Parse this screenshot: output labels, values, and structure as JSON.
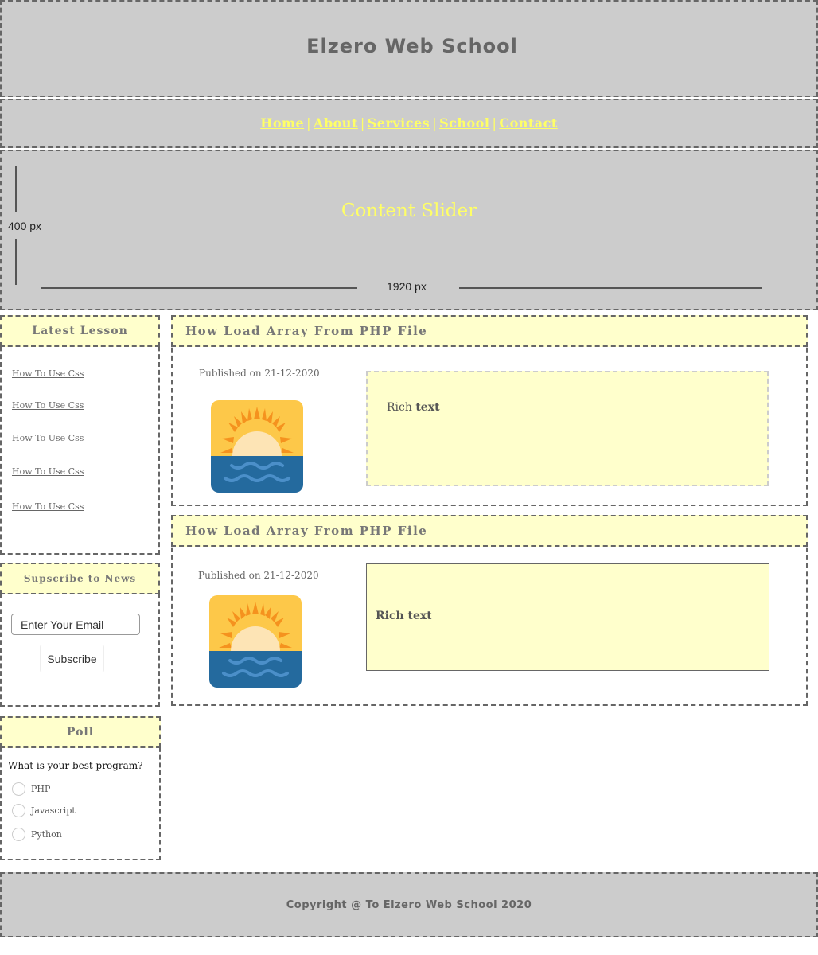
{
  "header": {
    "title": "Elzero Web School"
  },
  "nav": {
    "links": [
      "Home",
      "About",
      "Services",
      "School",
      "Contact"
    ],
    "separator": "|"
  },
  "slider": {
    "title": "Content Slider",
    "height_label": "400 px",
    "width_label": "1920 px"
  },
  "sidebar": {
    "latest": {
      "heading": "Latest Lesson",
      "links": [
        "How To Use Css",
        "How To Use Css",
        "How To Use Css",
        "How To Use Css",
        "How To Use Css"
      ]
    },
    "subscribe": {
      "heading": "Supscribe to News",
      "email_placeholder": "Enter Your Email",
      "button_label": "Subscribe"
    },
    "poll": {
      "heading": "Poll",
      "question": "What is your best program?",
      "options": [
        "PHP",
        "Javascript",
        "Python"
      ]
    }
  },
  "articles": [
    {
      "title": "How Load Array From PHP File",
      "published": "Published on 21-12-2020",
      "rich_plain": "Rich",
      "rich_bold": "text"
    },
    {
      "title": "How Load Array From PHP File",
      "published": "Published on 21-12-2020",
      "rich_bold_full": "Rich text"
    }
  ],
  "footer": {
    "copyright": "Copyright @ To Elzero Web School 2020"
  },
  "colors": {
    "background": "#cccccc",
    "heading_bg": "#ffffcc",
    "accent_yellow": "#ffff66",
    "text_gray": "#666666"
  }
}
